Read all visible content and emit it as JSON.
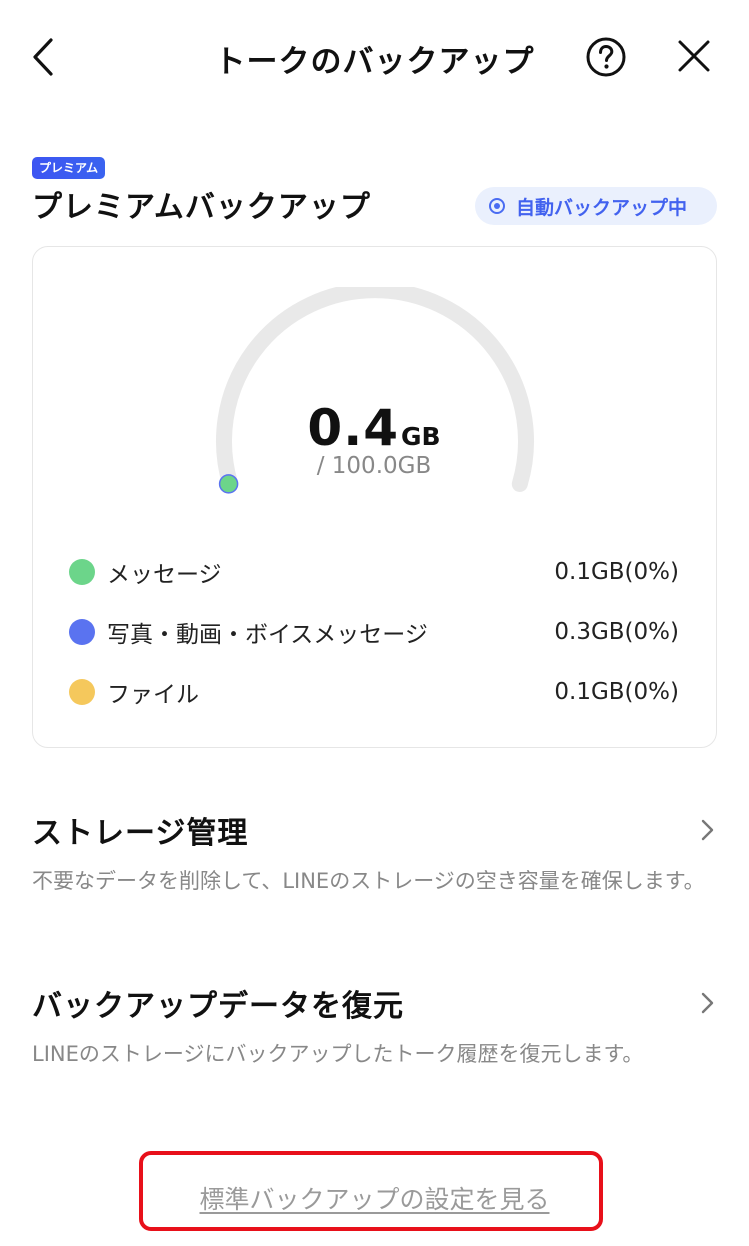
{
  "header": {
    "title": "トークのバックアップ",
    "back_icon": "chevron-left-icon",
    "help_icon": "question-circle-icon",
    "close_icon": "close-icon"
  },
  "premium": {
    "badge": "プレミアム",
    "title": "プレミアムバックアップ",
    "auto_status": "自動バックアップ中",
    "accent_color": "#4262ef"
  },
  "usage": {
    "used_value": "0.4",
    "used_unit": "GB",
    "total": "/ 100.0GB",
    "used_fraction": 0.004,
    "legend": [
      {
        "label": "メッセージ",
        "value": "0.1GB(0%)",
        "color": "#6cd58a"
      },
      {
        "label": "写真・動画・ボイスメッセージ",
        "value": "0.3GB(0%)",
        "color": "#5a73f0"
      },
      {
        "label": "ファイル",
        "value": "0.1GB(0%)",
        "color": "#f5c85c"
      }
    ]
  },
  "menu": {
    "storage": {
      "title": "ストレージ管理",
      "description": "不要なデータを削除して、LINEのストレージの空き容量を確保します。"
    },
    "restore": {
      "title": "バックアップデータを復元",
      "description": "LINEのストレージにバックアップしたトーク履歴を復元します。"
    }
  },
  "footer": {
    "standard_link": "標準バックアップの設定を見る"
  }
}
